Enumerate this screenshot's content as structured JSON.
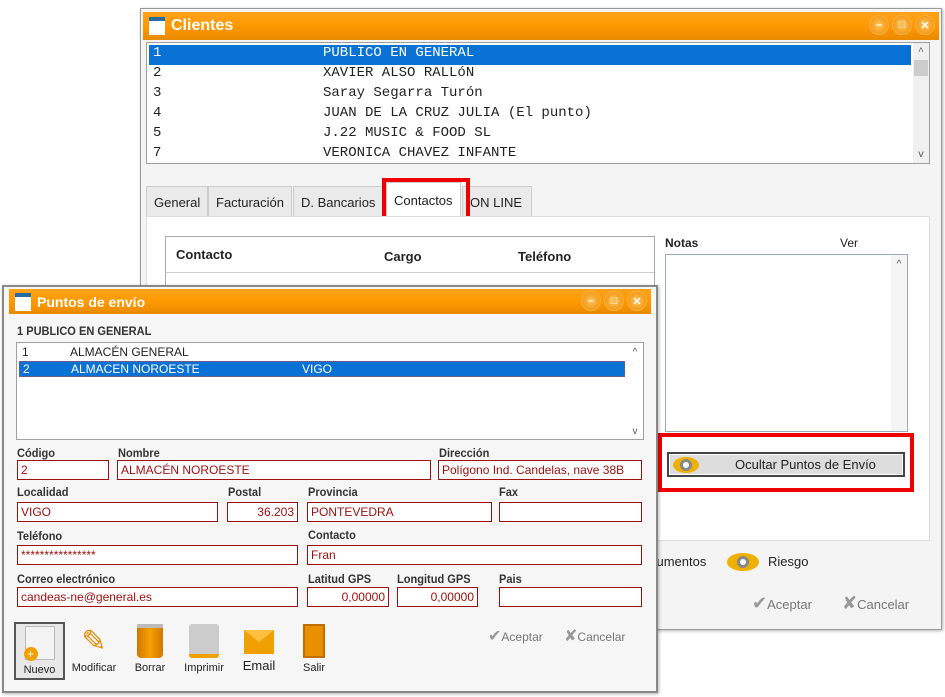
{
  "clientes": {
    "title": "Clientes",
    "rows": [
      {
        "code": "1",
        "name": "PUBLICO EN GENERAL"
      },
      {
        "code": "2",
        "name": "XAVIER ALSO RALLóN"
      },
      {
        "code": "3",
        "name": "Saray Segarra Turón"
      },
      {
        "code": "4",
        "name": "JUAN DE LA CRUZ JULIA (El punto)"
      },
      {
        "code": "5",
        "name": "J.22 MUSIC & FOOD SL"
      },
      {
        "code": "7",
        "name": "VERONICA CHAVEZ INFANTE"
      }
    ],
    "tabs": [
      "General",
      "Facturación",
      "D. Bancarios",
      "Contactos",
      "ON LINE"
    ],
    "active_tab": "Contactos",
    "contact_headers": [
      "Contacto",
      "Cargo",
      "Teléfono"
    ],
    "notas_label": "Notas",
    "ver_label": "Ver",
    "toggle_button": "Ocultar Puntos de Envío",
    "documentos_label": "cumentos",
    "riesgo_label": "Riesgo",
    "aceptar": "Aceptar",
    "cancelar": "Cancelar"
  },
  "puntos": {
    "title": "Puntos de envío",
    "client_label": "1 PUBLICO EN GENERAL",
    "rows": [
      {
        "code": "1",
        "name": "ALMACÉN GENERAL",
        "city": ""
      },
      {
        "code": "2",
        "name": "ALMACEN NOROESTE",
        "city": "VIGO"
      }
    ],
    "fields": {
      "codigo": {
        "label": "Código",
        "value": "2"
      },
      "nombre": {
        "label": "Nombre",
        "value": "ALMACÉN NOROESTE"
      },
      "direccion": {
        "label": "Dirección",
        "value": "Polígono Ind. Candelas, nave 38B"
      },
      "localidad": {
        "label": "Localidad",
        "value": "VIGO"
      },
      "postal": {
        "label": "Postal",
        "value": "36.203"
      },
      "provincia": {
        "label": "Provincia",
        "value": "PONTEVEDRA"
      },
      "fax": {
        "label": "Fax",
        "value": ""
      },
      "telefono": {
        "label": "Teléfono",
        "value": "****************"
      },
      "contacto": {
        "label": "Contacto",
        "value": "Fran"
      },
      "correo": {
        "label": "Correo electrónico",
        "value": "candeas-ne@general.es"
      },
      "latitud": {
        "label": "Latitud GPS",
        "value": "0,00000"
      },
      "longitud": {
        "label": "Longitud GPS",
        "value": "0,00000"
      },
      "pais": {
        "label": "Pais",
        "value": ""
      }
    },
    "toolbar": [
      "Nuevo",
      "Modificar",
      "Borrar",
      "Imprimir",
      "Email",
      "Salir"
    ],
    "aceptar": "Aceptar",
    "cancelar": "Cancelar"
  },
  "colors": {
    "titlebar": "#ff9900",
    "selection": "#0a72d4",
    "field_border": "#a01010",
    "highlight": "#ee0000"
  }
}
